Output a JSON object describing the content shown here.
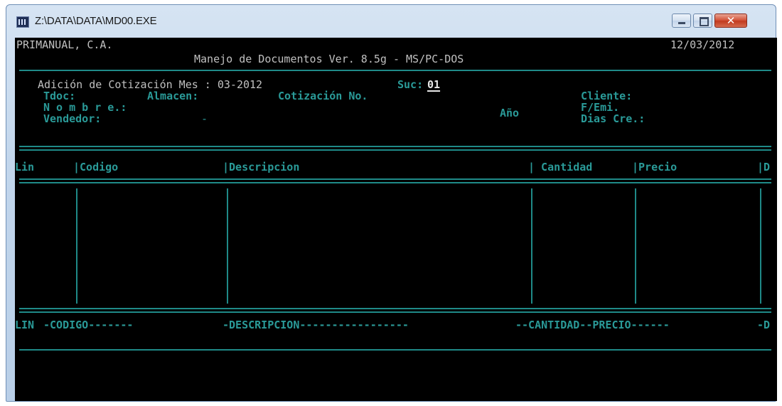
{
  "window": {
    "title": "Z:\\DATA\\DATA\\MD00.EXE",
    "controls": {
      "minimize": "–",
      "maximize": "□",
      "close": "✕"
    }
  },
  "header": {
    "company": "PRIMANUAL, C.A.",
    "date": "12/03/2012",
    "app_title": "Manejo de Documentos Ver. 8.5g - MS/PC-DOS"
  },
  "form": {
    "heading": "Adición de Cotización Mes : 03-2012",
    "suc_label": "Suc:",
    "suc_value": "01",
    "tdoc_label": "Tdoc:",
    "almacen_label": "Almacen:",
    "cotizacion_label": "Cotización No.",
    "cliente_label": "Cliente:",
    "nombre_label": "N o m b r e.:",
    "ano_label": "Año",
    "femi_label": "F/Emi.",
    "vendedor_label": "Vendedor:",
    "vendedor_value": "-",
    "dias_label": "Dias Cre.:"
  },
  "table": {
    "headers": {
      "lin": "Lin",
      "codigo": "|Codigo",
      "descripcion": "|Descripcion",
      "cantidad": "| Cantidad",
      "precio": "|Precio",
      "d": "|D"
    },
    "footer": {
      "lin": "LIN",
      "codigo": "-CODIGO-------",
      "descripcion": "-DESCRIPCION-----------------",
      "cantidad_precio": "--CANTIDAD--PRECIO------",
      "d": "-D"
    }
  },
  "colors": {
    "console_bg": "#000000",
    "text_white": "#c0c0c0",
    "text_cyan": "#2a9a98",
    "line_cyan": "#1f8a88",
    "title_bar": "#c2d6ec",
    "close_button": "#c23a1f"
  }
}
